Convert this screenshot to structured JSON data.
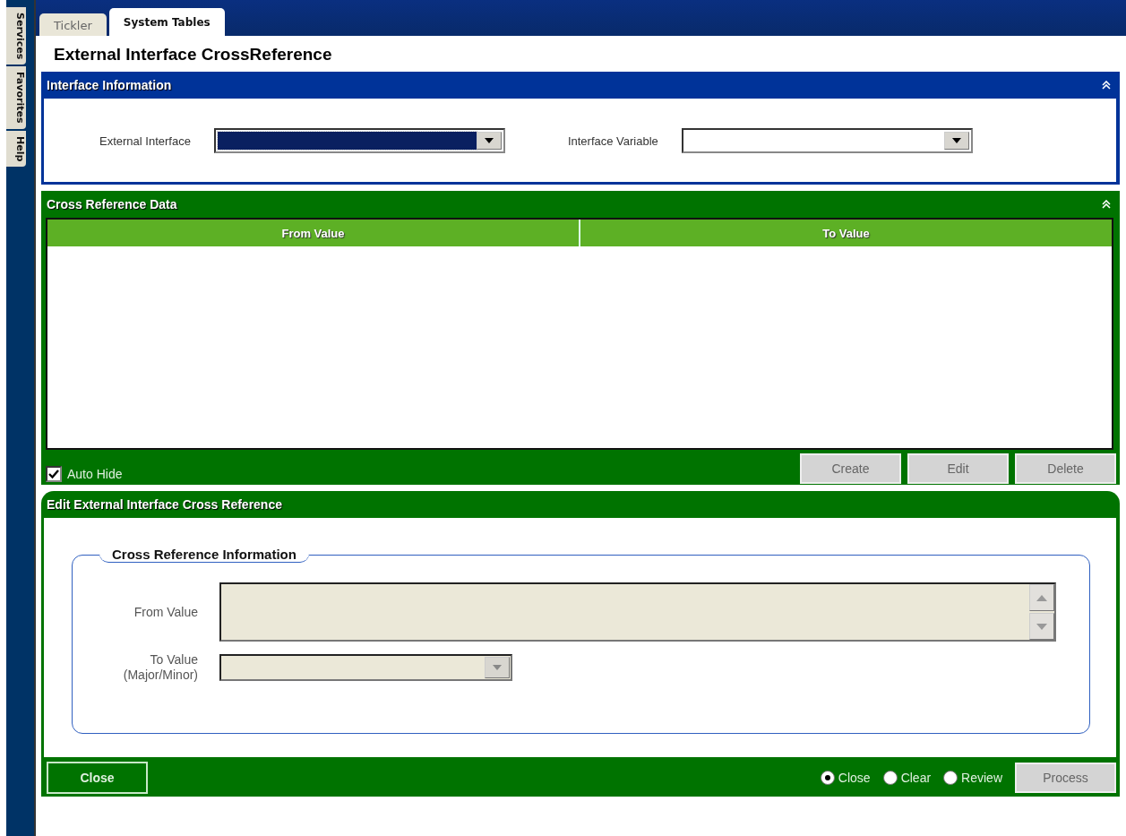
{
  "side_tabs": [
    {
      "label": "Services"
    },
    {
      "label": "Favorites"
    },
    {
      "label": "Help"
    }
  ],
  "tabs": [
    {
      "label": "Tickler",
      "selected": false
    },
    {
      "label": "System Tables",
      "selected": true
    }
  ],
  "title": "External Interface CrossReference",
  "interface_panel": {
    "title": "Interface Information",
    "fields": [
      {
        "label": "External Interface",
        "focused": true
      },
      {
        "label": "Interface Variable",
        "focused": false
      }
    ]
  },
  "data_panel": {
    "title": "Cross Reference Data",
    "columns": [
      "From Value",
      "To Value"
    ],
    "auto_hide": {
      "label": "Auto Hide",
      "checked": true
    },
    "buttons": [
      {
        "label": "Create",
        "disabled": true
      },
      {
        "label": "Edit",
        "disabled": true
      },
      {
        "label": "Delete",
        "disabled": true
      }
    ]
  },
  "edit_panel": {
    "title": "Edit External Interface Cross Reference",
    "group_title": "Cross Reference Information",
    "from_value": {
      "label": "From Value",
      "disabled": true
    },
    "to_value": {
      "label": "To Value",
      "sublabel": "(Major/Minor)",
      "disabled": true
    },
    "close_button": "Close",
    "options": [
      {
        "label": "Close",
        "selected": true
      },
      {
        "label": "Clear",
        "selected": false
      },
      {
        "label": "Review",
        "selected": false
      }
    ],
    "process_button": {
      "label": "Process",
      "disabled": true
    }
  }
}
